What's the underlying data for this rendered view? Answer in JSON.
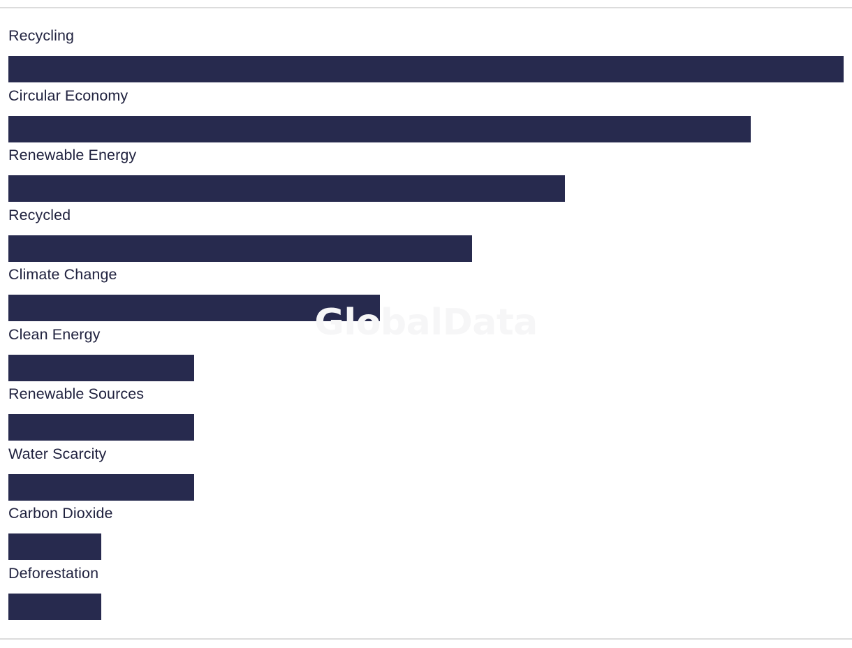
{
  "chart_data": {
    "type": "bar",
    "orientation": "horizontal",
    "title": "",
    "subtitle": "",
    "xlabel": "",
    "ylabel": "",
    "grid": false,
    "legend": null,
    "axis_visible": false,
    "value_labels_visible": false,
    "categories": [
      "Recycling",
      "Circular Economy",
      "Renewable Energy",
      "Recycled",
      "Climate Change",
      "Clean Energy",
      "Renewable Sources",
      "Water Scarcity",
      "Carbon Dioxide",
      "Deforestation"
    ],
    "values": [
      9,
      8,
      6,
      5,
      4,
      2,
      2,
      2,
      1,
      1
    ],
    "xlim": [
      0,
      9
    ],
    "bar_color": "#272a4e",
    "label_color": "#20223f",
    "background_color": "#ffffff",
    "rule_color": "#dcdcdc"
  },
  "watermark": {
    "text": "GlobalData",
    "color": "#f6f6f7"
  }
}
